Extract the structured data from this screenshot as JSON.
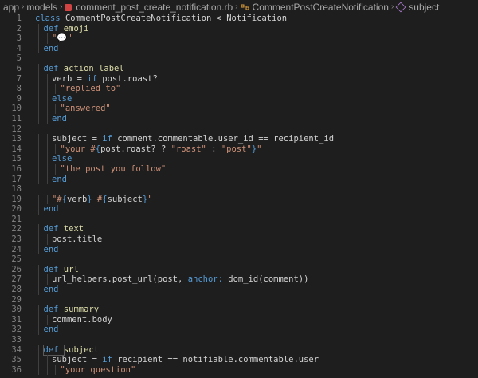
{
  "breadcrumb": {
    "items": [
      "app",
      "models",
      "comment_post_create_notification.rb",
      "CommentPostCreateNotification",
      "subject"
    ]
  },
  "lines": [
    {
      "n": "1",
      "indent": 0,
      "tokens": [
        [
          "kw",
          "class "
        ],
        [
          "cls",
          "CommentPostCreateNotification < Notification"
        ]
      ]
    },
    {
      "n": "2",
      "indent": 1,
      "tokens": [
        [
          "kw",
          "def "
        ],
        [
          "fn",
          "emoji"
        ]
      ]
    },
    {
      "n": "3",
      "indent": 2,
      "tokens": [
        [
          "str",
          "\"💬\""
        ]
      ]
    },
    {
      "n": "4",
      "indent": 1,
      "tokens": [
        [
          "kw",
          "end"
        ]
      ]
    },
    {
      "n": "5",
      "indent": 0,
      "tokens": []
    },
    {
      "n": "6",
      "indent": 1,
      "tokens": [
        [
          "kw",
          "def "
        ],
        [
          "fn",
          "action_label"
        ]
      ]
    },
    {
      "n": "7",
      "indent": 2,
      "tokens": [
        [
          "op",
          "verb = "
        ],
        [
          "kw",
          "if "
        ],
        [
          "op",
          "post.roast?"
        ]
      ]
    },
    {
      "n": "8",
      "indent": 3,
      "tokens": [
        [
          "str",
          "\"replied to\""
        ]
      ]
    },
    {
      "n": "9",
      "indent": 2,
      "tokens": [
        [
          "kw",
          "else"
        ]
      ]
    },
    {
      "n": "10",
      "indent": 3,
      "tokens": [
        [
          "str",
          "\"answered\""
        ]
      ]
    },
    {
      "n": "11",
      "indent": 2,
      "tokens": [
        [
          "kw",
          "end"
        ]
      ]
    },
    {
      "n": "12",
      "indent": 0,
      "tokens": []
    },
    {
      "n": "13",
      "indent": 2,
      "tokens": [
        [
          "op",
          "subject = "
        ],
        [
          "kw",
          "if "
        ],
        [
          "op",
          "comment.commentable.user_id == recipient_id"
        ]
      ]
    },
    {
      "n": "14",
      "indent": 3,
      "tokens": [
        [
          "str",
          "\"your #"
        ],
        [
          "kw",
          "{"
        ],
        [
          "op",
          "post.roast? ? "
        ],
        [
          "str",
          "\"roast\""
        ],
        [
          "op",
          " : "
        ],
        [
          "str",
          "\"post\""
        ],
        [
          "kw",
          "}"
        ],
        [
          "str",
          "\""
        ]
      ]
    },
    {
      "n": "15",
      "indent": 2,
      "tokens": [
        [
          "kw",
          "else"
        ]
      ]
    },
    {
      "n": "16",
      "indent": 3,
      "tokens": [
        [
          "str",
          "\"the post you follow\""
        ]
      ]
    },
    {
      "n": "17",
      "indent": 2,
      "tokens": [
        [
          "kw",
          "end"
        ]
      ]
    },
    {
      "n": "18",
      "indent": 0,
      "tokens": []
    },
    {
      "n": "19",
      "indent": 2,
      "tokens": [
        [
          "str",
          "\"#"
        ],
        [
          "kw",
          "{"
        ],
        [
          "op",
          "verb"
        ],
        [
          "kw",
          "}"
        ],
        [
          "str",
          " #"
        ],
        [
          "kw",
          "{"
        ],
        [
          "op",
          "subject"
        ],
        [
          "kw",
          "}"
        ],
        [
          "str",
          "\""
        ]
      ]
    },
    {
      "n": "20",
      "indent": 1,
      "tokens": [
        [
          "kw",
          "end"
        ]
      ]
    },
    {
      "n": "21",
      "indent": 0,
      "tokens": []
    },
    {
      "n": "22",
      "indent": 1,
      "tokens": [
        [
          "kw",
          "def "
        ],
        [
          "fn",
          "text"
        ]
      ]
    },
    {
      "n": "23",
      "indent": 2,
      "tokens": [
        [
          "op",
          "post.title"
        ]
      ]
    },
    {
      "n": "24",
      "indent": 1,
      "tokens": [
        [
          "kw",
          "end"
        ]
      ]
    },
    {
      "n": "25",
      "indent": 0,
      "tokens": []
    },
    {
      "n": "26",
      "indent": 1,
      "tokens": [
        [
          "kw",
          "def "
        ],
        [
          "fn",
          "url"
        ]
      ]
    },
    {
      "n": "27",
      "indent": 2,
      "tokens": [
        [
          "op",
          "url_helpers.post_url(post, "
        ],
        [
          "sym",
          "anchor:"
        ],
        [
          "op",
          " dom_id(comment)"
        ],
        [
          "op",
          ")"
        ]
      ]
    },
    {
      "n": "28",
      "indent": 1,
      "tokens": [
        [
          "kw",
          "end"
        ]
      ]
    },
    {
      "n": "29",
      "indent": 0,
      "tokens": []
    },
    {
      "n": "30",
      "indent": 1,
      "tokens": [
        [
          "kw",
          "def "
        ],
        [
          "fn",
          "summary"
        ]
      ]
    },
    {
      "n": "31",
      "indent": 2,
      "tokens": [
        [
          "op",
          "comment.body"
        ]
      ]
    },
    {
      "n": "32",
      "indent": 1,
      "tokens": [
        [
          "kw",
          "end"
        ]
      ]
    },
    {
      "n": "33",
      "indent": 0,
      "tokens": []
    },
    {
      "n": "34",
      "indent": 1,
      "tokens": [
        [
          "kw",
          "def "
        ],
        [
          "fn",
          "subject"
        ]
      ],
      "highlight_def": true
    },
    {
      "n": "35",
      "indent": 2,
      "tokens": [
        [
          "op",
          "subject = "
        ],
        [
          "kw",
          "if "
        ],
        [
          "op",
          "recipient == notifiable.commentable.user"
        ]
      ]
    },
    {
      "n": "36",
      "indent": 3,
      "tokens": [
        [
          "str",
          "\"your question\""
        ]
      ]
    }
  ]
}
